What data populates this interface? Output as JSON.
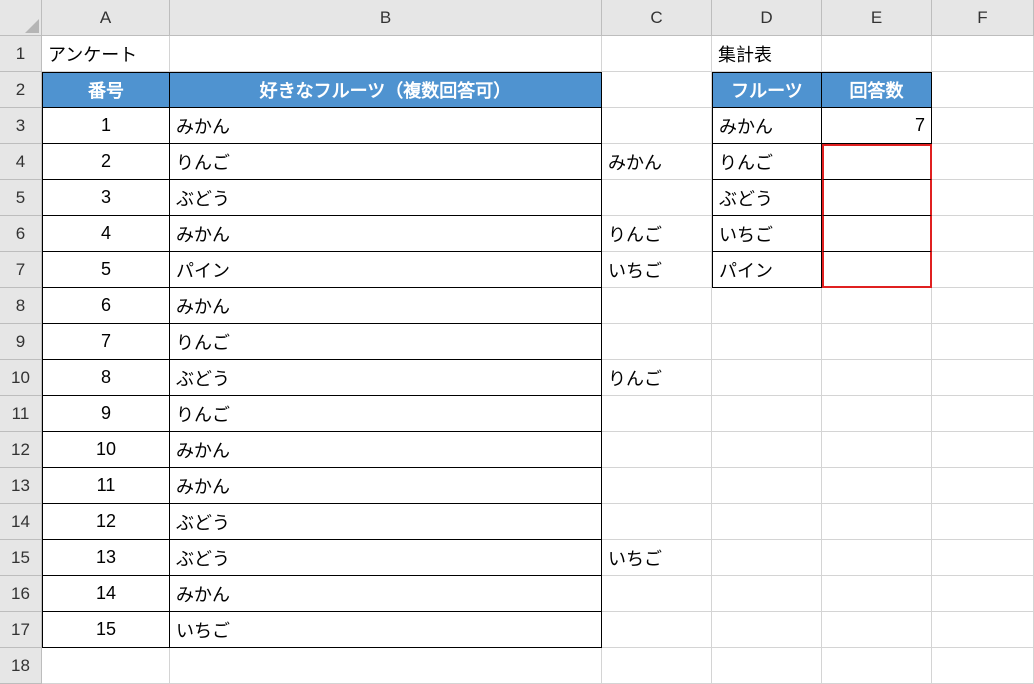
{
  "columns": [
    "A",
    "B",
    "C",
    "D",
    "E",
    "F"
  ],
  "row_count": 18,
  "labels": {
    "survey_title": "アンケート",
    "summary_title": "集計表"
  },
  "survey_headers": {
    "id": "番号",
    "fruit": "好きなフルーツ（複数回答可）"
  },
  "survey_rows": [
    {
      "id": "1",
      "fruit": "みかん"
    },
    {
      "id": "2",
      "fruit": "りんご"
    },
    {
      "id": "3",
      "fruit": "ぶどう"
    },
    {
      "id": "4",
      "fruit": "みかん"
    },
    {
      "id": "5",
      "fruit": "パイン"
    },
    {
      "id": "6",
      "fruit": "みかん"
    },
    {
      "id": "7",
      "fruit": "りんご"
    },
    {
      "id": "8",
      "fruit": "ぶどう"
    },
    {
      "id": "9",
      "fruit": "りんご"
    },
    {
      "id": "10",
      "fruit": "みかん"
    },
    {
      "id": "11",
      "fruit": "みかん"
    },
    {
      "id": "12",
      "fruit": "ぶどう"
    },
    {
      "id": "13",
      "fruit": "ぶどう"
    },
    {
      "id": "14",
      "fruit": "みかん"
    },
    {
      "id": "15",
      "fruit": "いちご"
    }
  ],
  "col_c": {
    "4": "みかん",
    "6": "りんご",
    "7": "いちご",
    "10": "りんご",
    "15": "いちご"
  },
  "summary_headers": {
    "fruit": "フルーツ",
    "count": "回答数"
  },
  "summary_rows": [
    {
      "fruit": "みかん",
      "count": "7"
    },
    {
      "fruit": "りんご",
      "count": ""
    },
    {
      "fruit": "ぶどう",
      "count": ""
    },
    {
      "fruit": "いちご",
      "count": ""
    },
    {
      "fruit": "パイン",
      "count": ""
    }
  ],
  "chart_data": {
    "type": "table",
    "title": "集計表",
    "categories": [
      "みかん",
      "りんご",
      "ぶどう",
      "いちご",
      "パイン"
    ],
    "values": [
      7,
      null,
      null,
      null,
      null
    ],
    "xlabel": "フルーツ",
    "ylabel": "回答数"
  }
}
